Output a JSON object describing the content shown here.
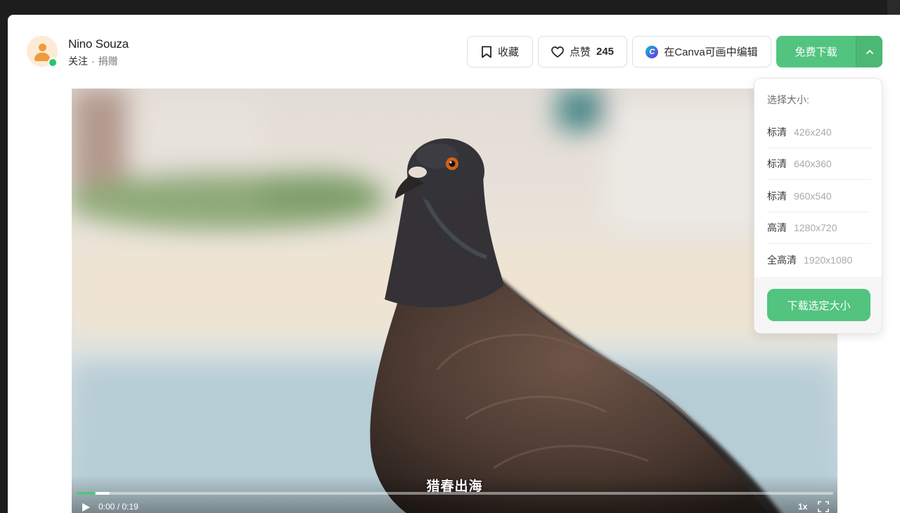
{
  "author": {
    "name": "Nino Souza",
    "follow": "关注",
    "separator": "·",
    "donate": "捐赠"
  },
  "actions": {
    "collect": "收藏",
    "like": "点赞",
    "like_count": "245",
    "canva": "在Canva可画中编辑",
    "canva_logo": "C",
    "download": "免费下载"
  },
  "download_menu": {
    "title": "选择大小:",
    "sizes": [
      {
        "quality": "标清",
        "resolution": "426x240"
      },
      {
        "quality": "标清",
        "resolution": "640x360"
      },
      {
        "quality": "标清",
        "resolution": "960x540"
      },
      {
        "quality": "高清",
        "resolution": "1280x720"
      },
      {
        "quality": "全高清",
        "resolution": "1920x1080"
      }
    ],
    "download_selected": "下载选定大小"
  },
  "video": {
    "subtitle": "猎春出海",
    "current_time": "0:00",
    "time_sep": " / ",
    "duration": "0:19",
    "speed": "1x",
    "played_fraction": 0.026,
    "buffered_fraction": 0.045
  },
  "colors": {
    "accent": "#52c47f",
    "avatar_bg": "#fdebd6",
    "avatar_fg": "#ef9b3a"
  }
}
